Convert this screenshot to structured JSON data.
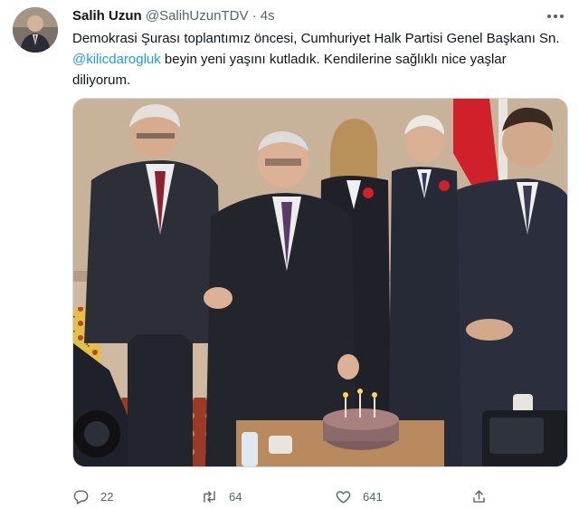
{
  "tweet": {
    "author_name": "Salih Uzun",
    "author_handle": "@SalihUzunTDV",
    "separator": "·",
    "time": "4s",
    "text_before": "Demokrasi Şurası toplantımız öncesi, Cumhuriyet Halk Partisi Genel Başkanı Sn. ",
    "mention": "@kilicdarogluk",
    "text_after": " beyin yeni yaşını kutladık. Kendilerine sağlıklı nice yaşlar diliyorum."
  },
  "actions": {
    "reply_count": "22",
    "retweet_count": "64",
    "like_count": "641"
  },
  "icons": {
    "more": "more-icon",
    "reply": "reply-icon",
    "retweet": "retweet-icon",
    "like": "heart-icon",
    "share": "share-icon"
  },
  "colors": {
    "link": "#1d9bf0",
    "secondary_text": "#536471",
    "primary_text": "#0f1419"
  }
}
